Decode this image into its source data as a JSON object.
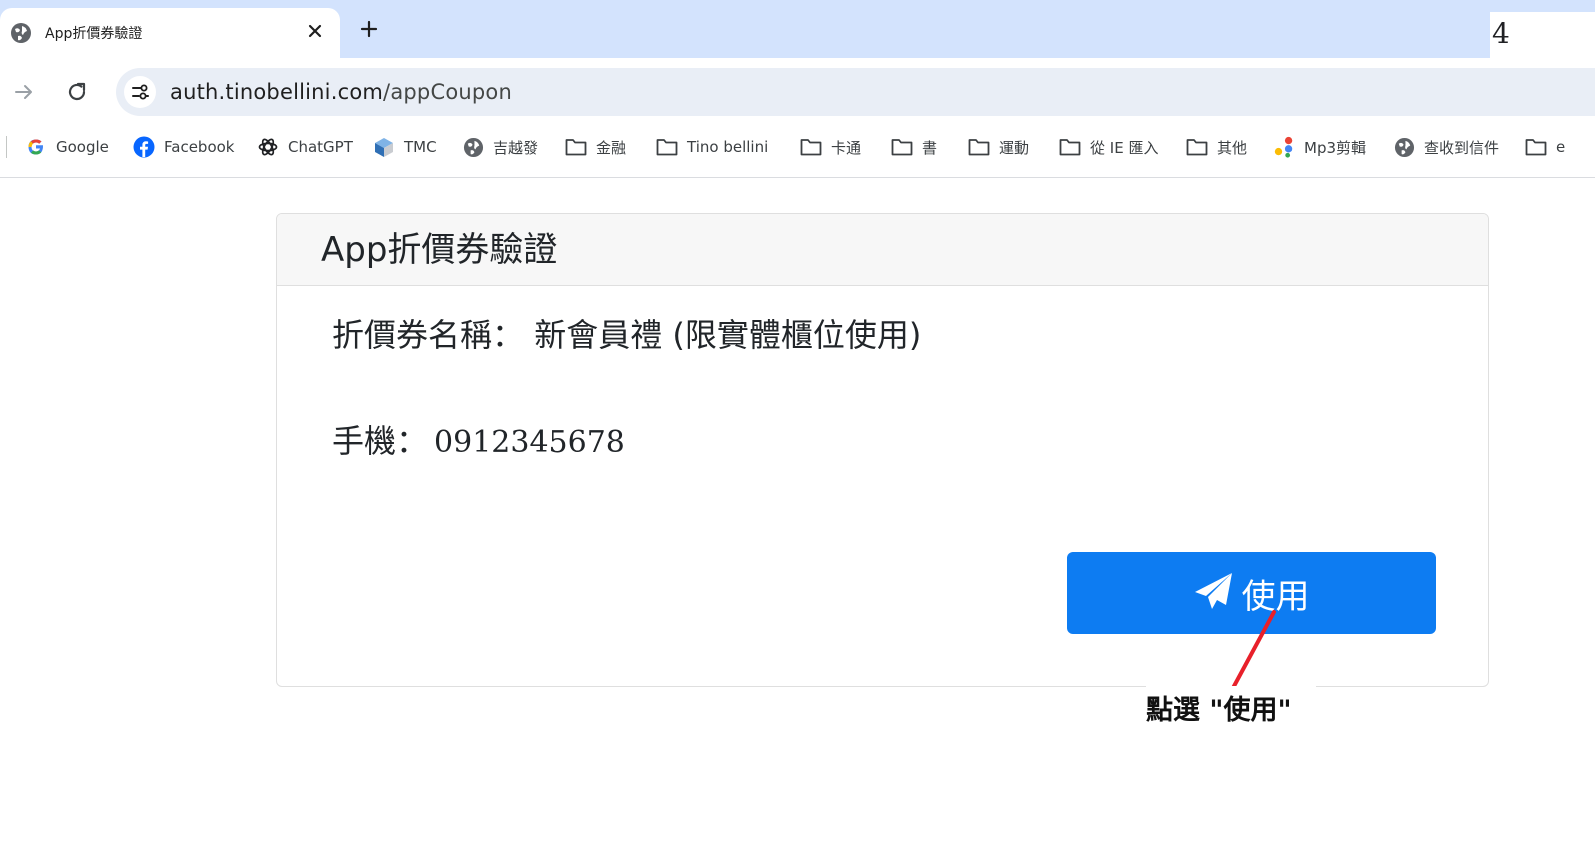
{
  "browser": {
    "tab_title": "App折價券驗證",
    "corner_text": "4",
    "url_host": "auth.tinobellini.com",
    "url_path": "/appCoupon"
  },
  "bookmarks": [
    {
      "label": "Google",
      "icon": "google-icon"
    },
    {
      "label": "Facebook",
      "icon": "facebook-icon"
    },
    {
      "label": "ChatGPT",
      "icon": "chatgpt-icon"
    },
    {
      "label": "TMC",
      "icon": "tmc-icon"
    },
    {
      "label": "吉越發",
      "icon": "globe-icon"
    },
    {
      "label": "金融",
      "icon": "folder-icon"
    },
    {
      "label": "Tino bellini",
      "icon": "folder-icon"
    },
    {
      "label": "卡通",
      "icon": "folder-icon"
    },
    {
      "label": "書",
      "icon": "folder-icon"
    },
    {
      "label": "運動",
      "icon": "folder-icon"
    },
    {
      "label": "從 IE 匯入",
      "icon": "folder-icon"
    },
    {
      "label": "其他",
      "icon": "folder-icon"
    },
    {
      "label": "Mp3剪輯",
      "icon": "mp3-icon"
    },
    {
      "label": "查收到信件",
      "icon": "globe-icon"
    },
    {
      "label": "e",
      "icon": "folder-icon"
    }
  ],
  "card": {
    "header": "App折價券驗證",
    "coupon_label": "折價券名稱：",
    "coupon_value": "新會員禮 (限實體櫃位使用)",
    "phone_label": "手機：",
    "phone_value": "0912345678",
    "use_button_label": "使用"
  },
  "annotation": {
    "text": "點選 \"使用\"",
    "color": "#e8202a"
  },
  "colors": {
    "tab_strip": "#d3e3fd",
    "omnibox": "#e9eef6",
    "button": "#0d7cf2"
  }
}
